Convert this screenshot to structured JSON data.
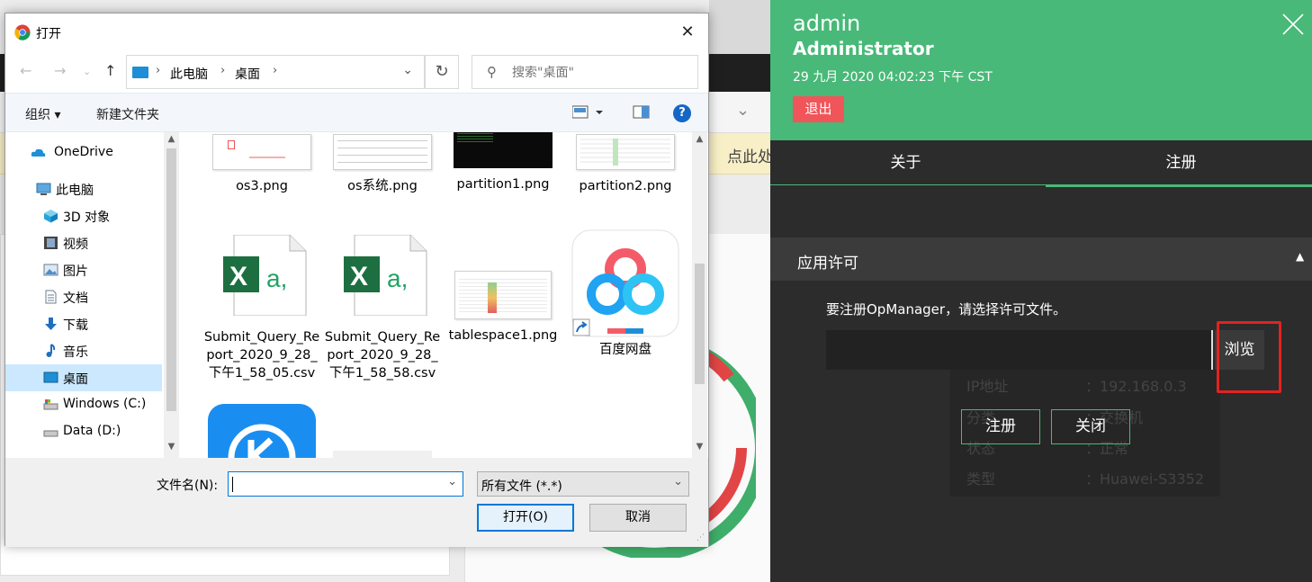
{
  "background": {
    "banner_text": "点此处立即..."
  },
  "dialog": {
    "title": "打开",
    "address": {
      "crumbs": [
        "此电脑",
        "桌面"
      ]
    },
    "search_placeholder": "搜索\"桌面\"",
    "commands": {
      "organize": "组织 ▾",
      "new_folder": "新建文件夹"
    },
    "nav_items": [
      {
        "label": "OneDrive",
        "icon": "cloud-icon"
      },
      {
        "label": "此电脑",
        "icon": "computer-icon"
      },
      {
        "label": "3D 对象",
        "icon": "cube-icon"
      },
      {
        "label": "视频",
        "icon": "video-icon"
      },
      {
        "label": "图片",
        "icon": "picture-icon"
      },
      {
        "label": "文档",
        "icon": "document-icon"
      },
      {
        "label": "下载",
        "icon": "download-icon"
      },
      {
        "label": "音乐",
        "icon": "music-icon"
      },
      {
        "label": "桌面",
        "icon": "desktop-icon",
        "selected": true
      },
      {
        "label": "Windows (C:)",
        "icon": "drive-c-icon"
      },
      {
        "label": "Data (D:)",
        "icon": "drive-d-icon"
      }
    ],
    "files": [
      {
        "name": "os3.png",
        "type": "screenshot"
      },
      {
        "name": "os系统.png",
        "type": "screenshot"
      },
      {
        "name": "partition1.png",
        "type": "terminal-screenshot"
      },
      {
        "name": "partition2.png",
        "type": "screenshot"
      },
      {
        "name": "Submit_Query_Report_2020_9_28_下午1_58_05.csv",
        "type": "csv"
      },
      {
        "name": "Submit_Query_Report_2020_9_28_下午1_58_58.csv",
        "type": "csv"
      },
      {
        "name": "tablespace1.png",
        "type": "screenshot"
      },
      {
        "name": "百度网盘",
        "type": "baidu-shortcut"
      }
    ],
    "filename_label": "文件名(N):",
    "filename_value": "",
    "filetype_value": "所有文件 (*.*)",
    "open_button": "打开(O)",
    "cancel_button": "取消"
  },
  "panel": {
    "user": "admin",
    "role": "Administrator",
    "timestamp": "29 九月 2020 04:02:23 下午 CST",
    "logout": "退出",
    "tabs": [
      "关于",
      "注册"
    ],
    "active_tab": "注册",
    "section_title": "应用许可",
    "instruction": "要注册OpManager，请选择许可文件。",
    "browse": "浏览",
    "register_button": "注册",
    "close_button": "关闭",
    "ghost_rows": [
      {
        "key": "IP地址",
        "value": "：192.168.0.3"
      },
      {
        "key": "分类",
        "value": "：交换机"
      },
      {
        "key": "状态",
        "value": "：正常"
      },
      {
        "key": "类型",
        "value": "：Huawei-S3352"
      }
    ],
    "accent": "#48b978",
    "logout_color": "#f0555a",
    "highlight_color": "#e32222"
  }
}
